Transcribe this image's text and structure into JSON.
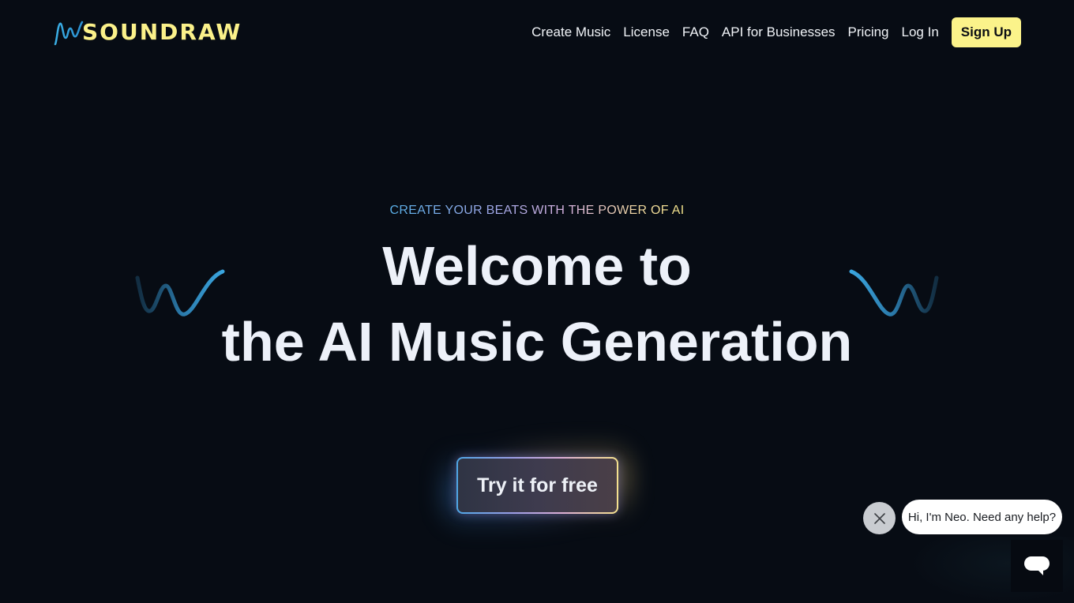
{
  "header": {
    "logo_text": "SOUNDRAW",
    "nav": [
      {
        "label": "Create Music"
      },
      {
        "label": "License"
      },
      {
        "label": "FAQ"
      },
      {
        "label": "API for Businesses"
      },
      {
        "label": "Pricing"
      },
      {
        "label": "Log In"
      }
    ],
    "signup_label": "Sign Up"
  },
  "hero": {
    "eyebrow": "CREATE YOUR BEATS WITH THE POWER OF AI",
    "title_line1": "Welcome to",
    "title_line2": "the AI Music Generation",
    "cta_label": "Try it for free"
  },
  "chat": {
    "greeting": "Hi, I'm Neo. Need any help?",
    "close_icon": "close-icon",
    "launcher_icon": "chat-bubble-icon"
  },
  "colors": {
    "background": "#070c14",
    "brand_yellow": "#fbf18a",
    "accent_blue": "#3aa6e0",
    "text": "#edf1f9"
  }
}
